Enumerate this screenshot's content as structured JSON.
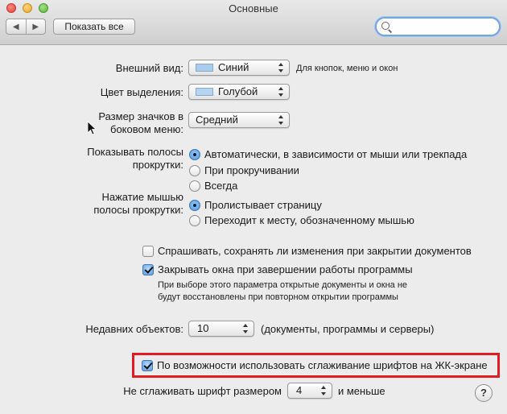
{
  "window": {
    "title": "Основные"
  },
  "toolbar": {
    "back_glyph": "◀",
    "forward_glyph": "▶",
    "show_all_label": "Показать все",
    "search_placeholder": ""
  },
  "appearance": {
    "label": "Внешний вид:",
    "value": "Синий",
    "note": "Для кнопок, меню и окон",
    "swatch_color": "#a9cdee"
  },
  "highlight_color": {
    "label": "Цвет выделения:",
    "value": "Голубой",
    "swatch_color": "#b5d5f3"
  },
  "sidebar_icon_size": {
    "label_line1": "Размер значков в",
    "label_line2": "боковом меню:",
    "value": "Средний"
  },
  "show_scrollbars": {
    "label_line1": "Показывать полосы",
    "label_line2": "прокрутки:",
    "options": [
      "Автоматически, в зависимости от мыши или трекпада",
      "При прокручивании",
      "Всегда"
    ],
    "selected_index": 0
  },
  "scrollbar_click": {
    "label_line1": "Нажатие мышью",
    "label_line2": "полосы прокрутки:",
    "options": [
      "Пролистывает страницу",
      "Переходит к месту, обозначенному мышью"
    ],
    "selected_index": 0
  },
  "documents": {
    "ask_save_label": "Спрашивать, сохранять ли изменения при закрытии документов",
    "ask_save_checked": false,
    "close_windows_label": "Закрывать окна при завершении работы программы",
    "close_windows_checked": true,
    "close_windows_note_line1": "При выборе этого параметра открытые документы и окна не",
    "close_windows_note_line2": "будут восстановлены при повторном открытии программы"
  },
  "recent_items": {
    "label": "Недавних объектов:",
    "value": "10",
    "note": "(документы, программы и серверы)"
  },
  "font_smoothing": {
    "label": "По возможности использовать сглаживание шрифтов на ЖК-экране",
    "checked": true,
    "highlight_border_color": "#e01b24"
  },
  "smoothing_threshold": {
    "label": "Не сглаживать шрифт размером",
    "value": "4",
    "suffix": "и меньше"
  },
  "help": {
    "glyph": "?"
  }
}
